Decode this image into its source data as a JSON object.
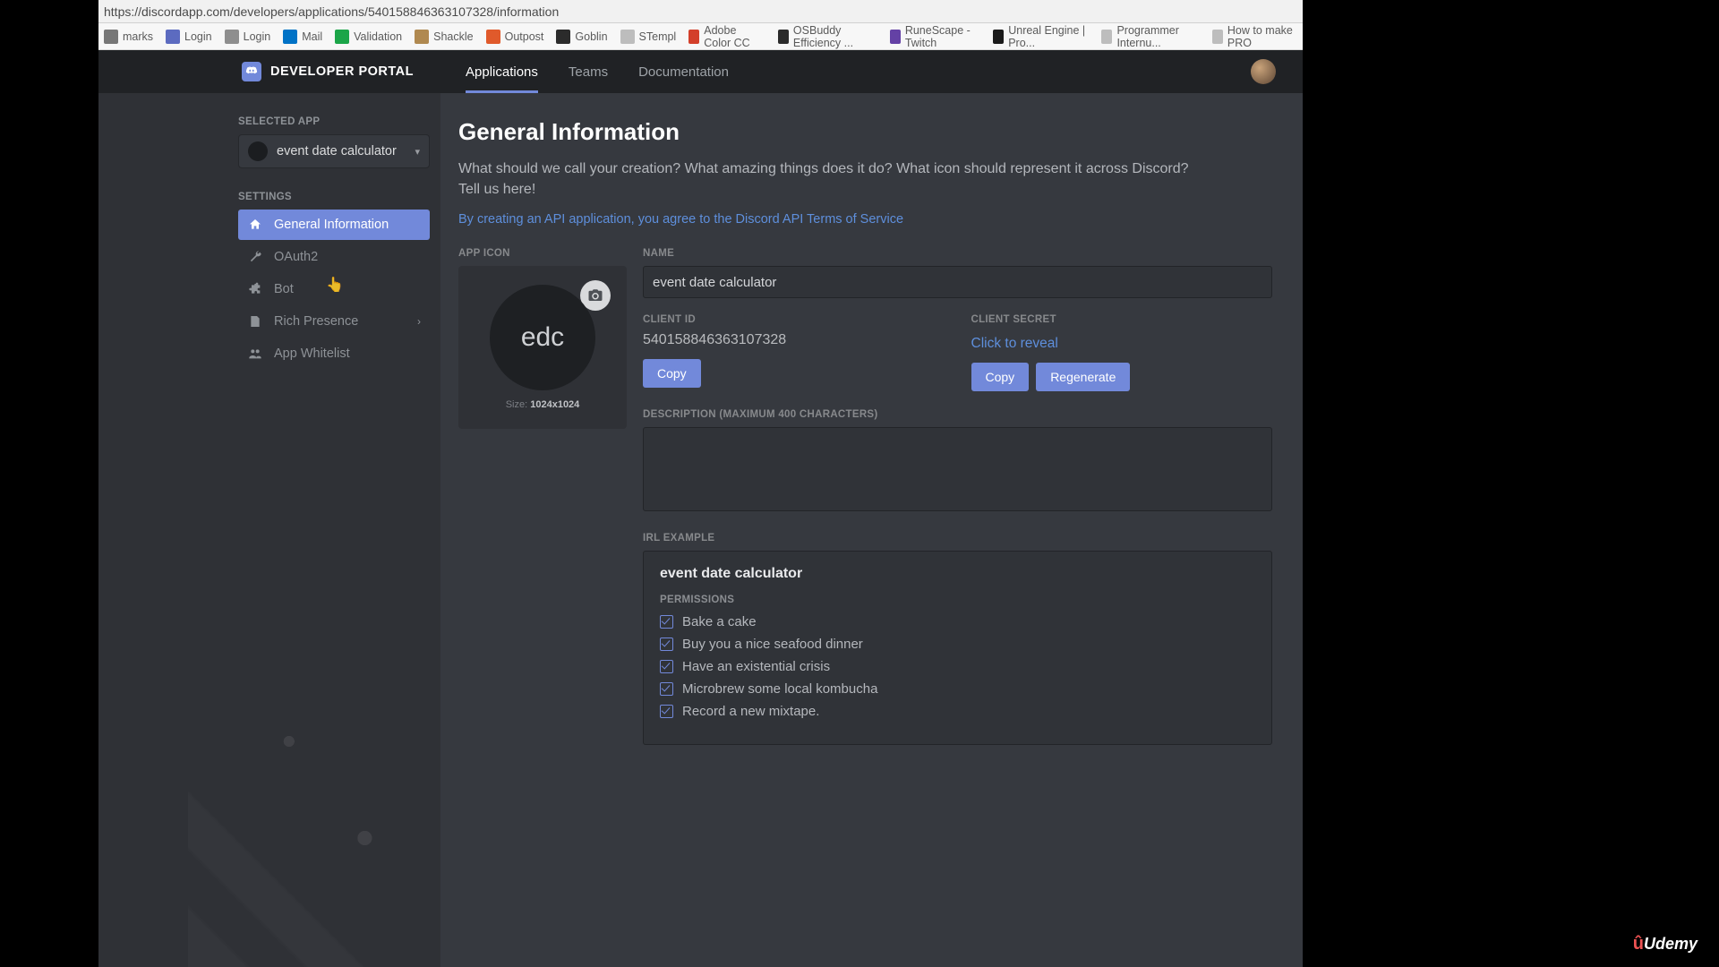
{
  "url": "https://discordapp.com/developers/applications/540158846363107328/information",
  "bookmarks": [
    {
      "label": "marks",
      "color": "#777"
    },
    {
      "label": "Login",
      "color": "#5c6bc0"
    },
    {
      "label": "Login",
      "color": "#8e8e8e"
    },
    {
      "label": "Mail",
      "color": "#0072c6"
    },
    {
      "label": "Validation",
      "color": "#1ba548"
    },
    {
      "label": "Shackle",
      "color": "#b08950"
    },
    {
      "label": "Outpost",
      "color": "#e05a2b"
    },
    {
      "label": "Goblin",
      "color": "#2b2b2b"
    },
    {
      "label": "STempl",
      "color": "#bdbdbd"
    },
    {
      "label": "Adobe Color CC",
      "color": "#d33f2a"
    },
    {
      "label": "OSBuddy Efficiency ...",
      "color": "#2b2b2b"
    },
    {
      "label": "RuneScape - Twitch",
      "color": "#6441a5"
    },
    {
      "label": "Unreal Engine | Pro...",
      "color": "#1b1b1b"
    },
    {
      "label": "Programmer Internu...",
      "color": "#bdbdbd"
    },
    {
      "label": "How to make PRO",
      "color": "#bdbdbd"
    }
  ],
  "brand": "DEVELOPER PORTAL",
  "nav": {
    "applications": "Applications",
    "teams": "Teams",
    "documentation": "Documentation"
  },
  "sidebar": {
    "selected_app_label": "SELECTED APP",
    "selected_app_name": "event date calculator",
    "settings_label": "SETTINGS",
    "items": [
      {
        "label": "General Information"
      },
      {
        "label": "OAuth2"
      },
      {
        "label": "Bot"
      },
      {
        "label": "Rich Presence"
      },
      {
        "label": "App Whitelist"
      }
    ]
  },
  "main": {
    "title": "General Information",
    "subtitle": "What should we call your creation? What amazing things does it do? What icon should represent it across Discord? Tell us here!",
    "tos": "By creating an API application, you agree to the Discord API Terms of Service",
    "app_icon_label": "APP ICON",
    "icon_initials": "edc",
    "icon_size_prefix": "Size:",
    "icon_size_value": "1024x1024",
    "name_label": "NAME",
    "name_value": "event date calculator",
    "client_id_label": "CLIENT ID",
    "client_id_value": "540158846363107328",
    "client_secret_label": "CLIENT SECRET",
    "client_secret_reveal": "Click to reveal",
    "copy": "Copy",
    "regenerate": "Regenerate",
    "description_label": "DESCRIPTION (MAXIMUM 400 CHARACTERS)",
    "irl_label": "IRL EXAMPLE",
    "irl_appname": "event date calculator",
    "permissions_label": "PERMISSIONS",
    "permissions": [
      "Bake a cake",
      "Buy you a nice seafood dinner",
      "Have an existential crisis",
      "Microbrew some local kombucha",
      "Record a new mixtape."
    ]
  },
  "watermark": "Udemy"
}
